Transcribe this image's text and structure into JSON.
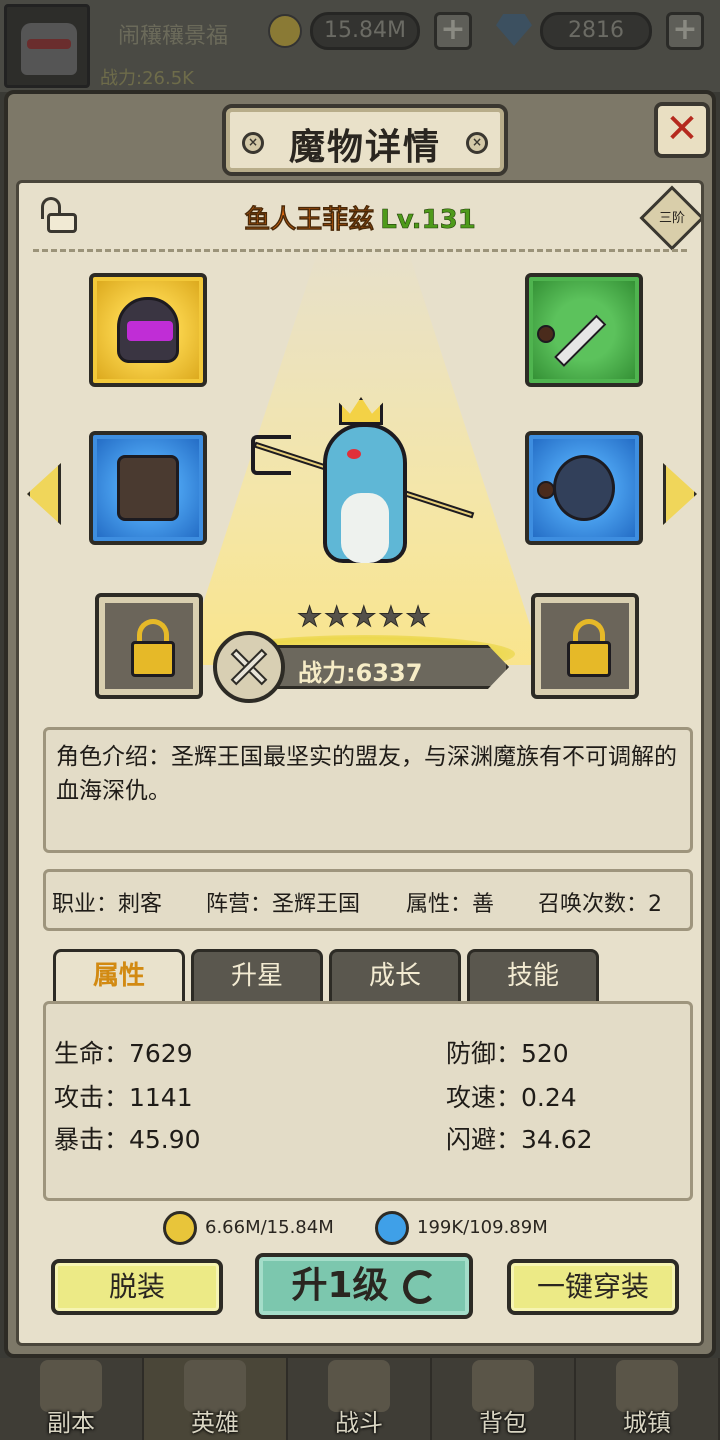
{
  "topbar": {
    "player_name": "闹穰穰景福",
    "power": "战力:26.5K",
    "gold": "15.84M",
    "gems": "2816",
    "plus": "+"
  },
  "modal": {
    "title": "魔物详情",
    "close": "✕",
    "rank": "三阶",
    "hero_name": "鱼人王菲兹",
    "hero_level": "Lv.131",
    "stars": 5,
    "combat_power": "战力:6337",
    "description": "角色介绍：圣辉王国最坚实的盟友，与深渊魔族有不可调解的血海深仇。",
    "meta": {
      "job": "职业：刺客",
      "camp": "阵营：圣辉王国",
      "alignment": "属性：善",
      "summons": "召唤次数：2"
    },
    "tabs": [
      "属性",
      "升星",
      "成长",
      "技能"
    ],
    "active_tab": 0,
    "stats": {
      "hp": "生命：7629",
      "def": "防御：520",
      "atk": "攻击：1141",
      "aspd": "攻速：0.24",
      "crit": "暴击：45.90",
      "dodge": "闪避：34.62"
    },
    "cost_gold": "6.66M/15.84M",
    "cost_exp": "199K/109.89M",
    "buttons": {
      "unequip": "脱装",
      "level_up": "升1级",
      "auto_equip": "一键穿装"
    }
  },
  "bottomnav": [
    "副本",
    "英雄",
    "战斗",
    "背包",
    "城镇"
  ],
  "colors": {
    "accent_gold": "#f3c93a",
    "accent_green": "#4fb44f",
    "accent_blue": "#3e8ee0",
    "close_red": "#b52a1e",
    "name_orange": "#e06a10",
    "level_green": "#4e9a1a"
  }
}
